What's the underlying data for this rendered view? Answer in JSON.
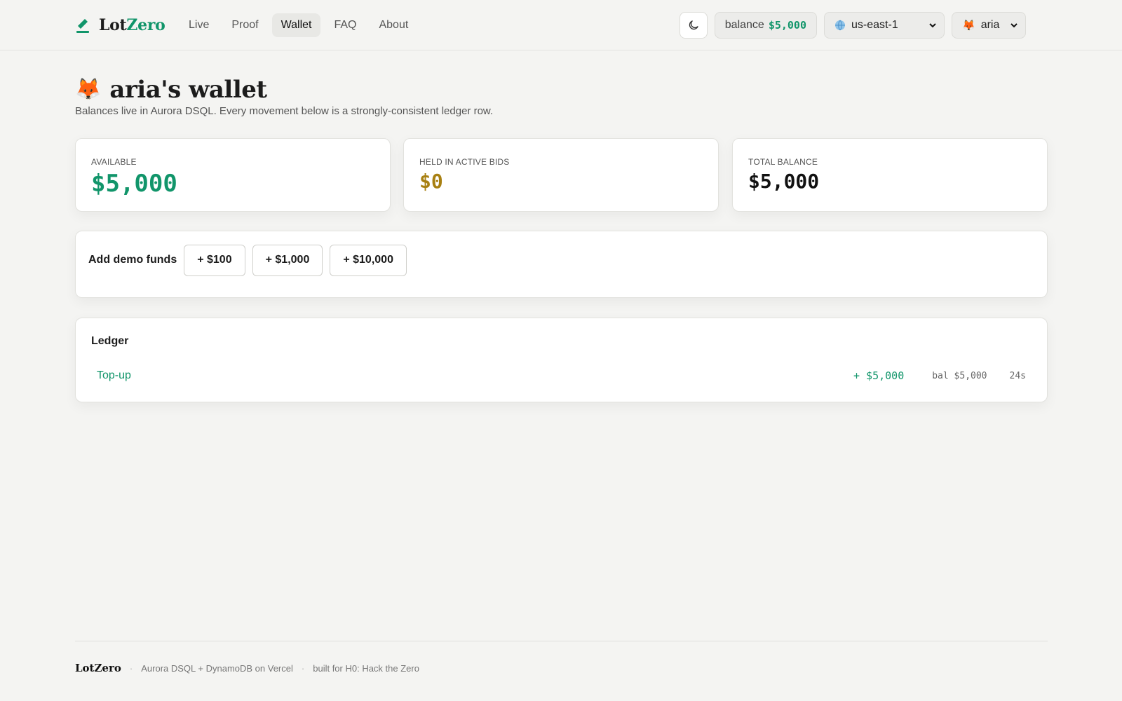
{
  "brand": {
    "name_part1": "Lot",
    "name_part2": "Zero"
  },
  "nav": {
    "items": [
      {
        "label": "Live",
        "active": false
      },
      {
        "label": "Proof",
        "active": false
      },
      {
        "label": "Wallet",
        "active": true
      },
      {
        "label": "FAQ",
        "active": false
      },
      {
        "label": "About",
        "active": false
      }
    ]
  },
  "header": {
    "theme_icon": "moon-icon",
    "balance_label": "balance",
    "balance_value": "$5,000",
    "region": {
      "icon": "globe-icon",
      "value": "us-east-1"
    },
    "user": {
      "avatar": "🦊",
      "value": "aria"
    }
  },
  "page": {
    "avatar": "🦊",
    "title": "aria's wallet",
    "subtitle": "Balances live in Aurora DSQL. Every movement below is a strongly-consistent ledger row."
  },
  "stats": [
    {
      "label": "AVAILABLE",
      "value": "$5,000",
      "color": "#11956a"
    },
    {
      "label": "HELD IN ACTIVE BIDS",
      "value": "$0",
      "color": "#a88012"
    },
    {
      "label": "TOTAL BALANCE",
      "value": "$5,000",
      "color": "#111111"
    }
  ],
  "funds": {
    "label": "Add demo funds",
    "buttons": [
      "+ $100",
      "+ $1,000",
      "+ $10,000"
    ]
  },
  "ledger": {
    "title": "Ledger",
    "rows": [
      {
        "kind": "Top-up",
        "amount": "+ $5,000",
        "balance": "bal $5,000",
        "time": "24s"
      }
    ]
  },
  "footer": {
    "brand": "LotZero",
    "separator": "·",
    "stack": "Aurora DSQL + DynamoDB on Vercel",
    "credit": "built for H0: Hack the Zero"
  },
  "colors": {
    "accent": "#11956a",
    "held": "#a88012",
    "background": "#f4f4f2"
  }
}
